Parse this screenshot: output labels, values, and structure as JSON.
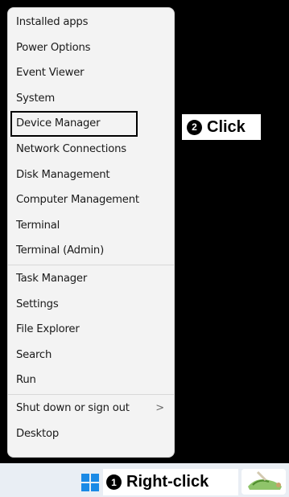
{
  "menu": {
    "items": [
      {
        "label": "Installed apps"
      },
      {
        "label": "Power Options"
      },
      {
        "label": "Event Viewer"
      },
      {
        "label": "System"
      },
      {
        "label": "Device Manager"
      },
      {
        "label": "Network Connections"
      },
      {
        "label": "Disk Management"
      },
      {
        "label": "Computer Management"
      },
      {
        "label": "Terminal"
      },
      {
        "label": "Terminal (Admin)"
      },
      {
        "label": "Task Manager"
      },
      {
        "label": "Settings"
      },
      {
        "label": "File Explorer"
      },
      {
        "label": "Search"
      },
      {
        "label": "Run"
      },
      {
        "label": "Shut down or sign out"
      },
      {
        "label": "Desktop"
      }
    ],
    "chevron": ">"
  },
  "annotations": {
    "step1_number": "1",
    "step1_text": "Right-click",
    "step2_number": "2",
    "step2_text": "Click"
  },
  "colors": {
    "highlight_outline": "#000000",
    "windows_logo": "#1a8ae6"
  }
}
